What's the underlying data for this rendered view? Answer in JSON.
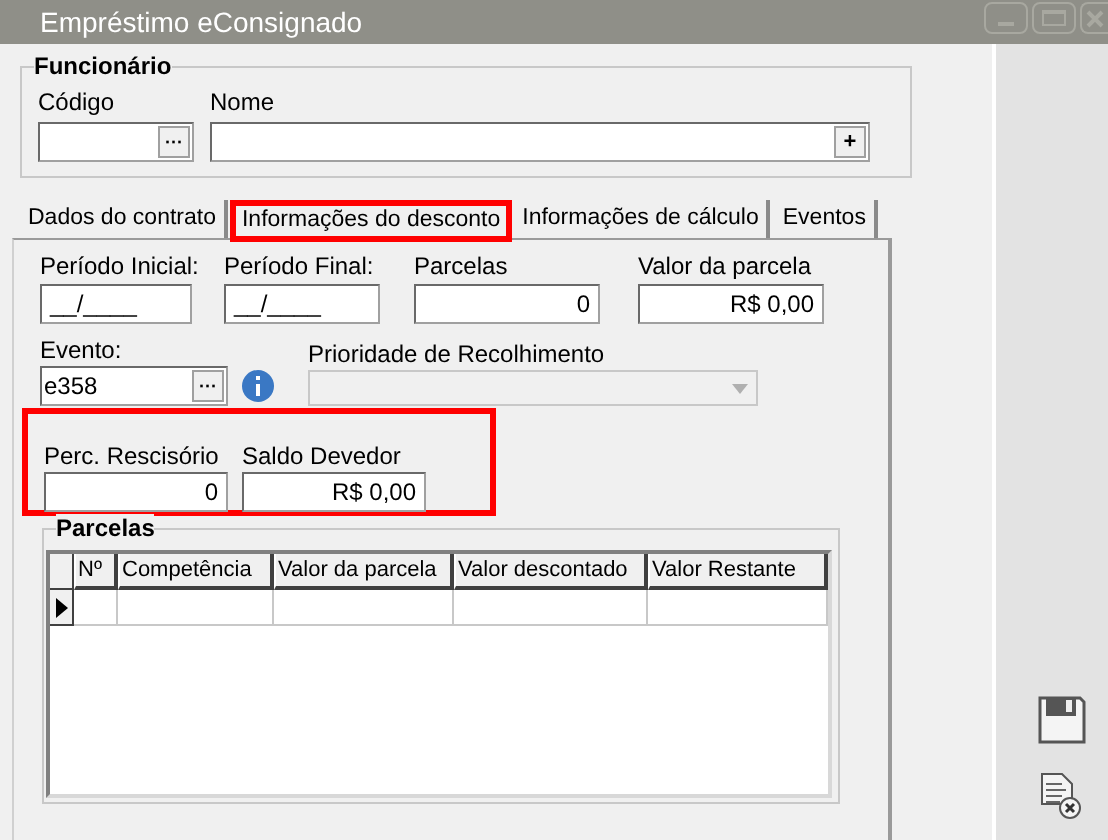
{
  "window": {
    "title": "Empréstimo eConsignado"
  },
  "funcionario": {
    "title": "Funcionário",
    "codigo_label": "Código",
    "codigo_button": "···",
    "nome_label": "Nome",
    "nome_button": "+"
  },
  "tabs": [
    {
      "label": "Dados do contrato",
      "selected": false,
      "highlighted": false
    },
    {
      "label": "Informações do desconto",
      "selected": true,
      "highlighted": true
    },
    {
      "label": "Informações de cálculo",
      "selected": false,
      "highlighted": false
    },
    {
      "label": "Eventos",
      "selected": false,
      "highlighted": false
    }
  ],
  "row1": [
    {
      "label": "Período Inicial:",
      "value": "__/____",
      "kind": "date"
    },
    {
      "label": "Período Final:",
      "value": "__/____",
      "kind": "date"
    },
    {
      "label": "Parcelas",
      "value": "0",
      "kind": "number"
    },
    {
      "label": "Valor da parcela",
      "value": "R$ 0,00",
      "kind": "number"
    }
  ],
  "evento": {
    "label": "Evento:",
    "value": "e358",
    "button": "···"
  },
  "prioridade": {
    "label": "Prioridade de Recolhimento",
    "disabled": true
  },
  "rescisao": {
    "highlighted": true,
    "fields": [
      {
        "label": "Perc. Rescisório",
        "value": "0"
      },
      {
        "label": "Saldo Devedor",
        "value": "R$ 0,00"
      }
    ]
  },
  "parcelas": {
    "title": "Parcelas",
    "columns": [
      "Nº",
      "Competência",
      "Valor da parcela",
      "Valor descontado",
      "Valor Restante"
    ]
  }
}
